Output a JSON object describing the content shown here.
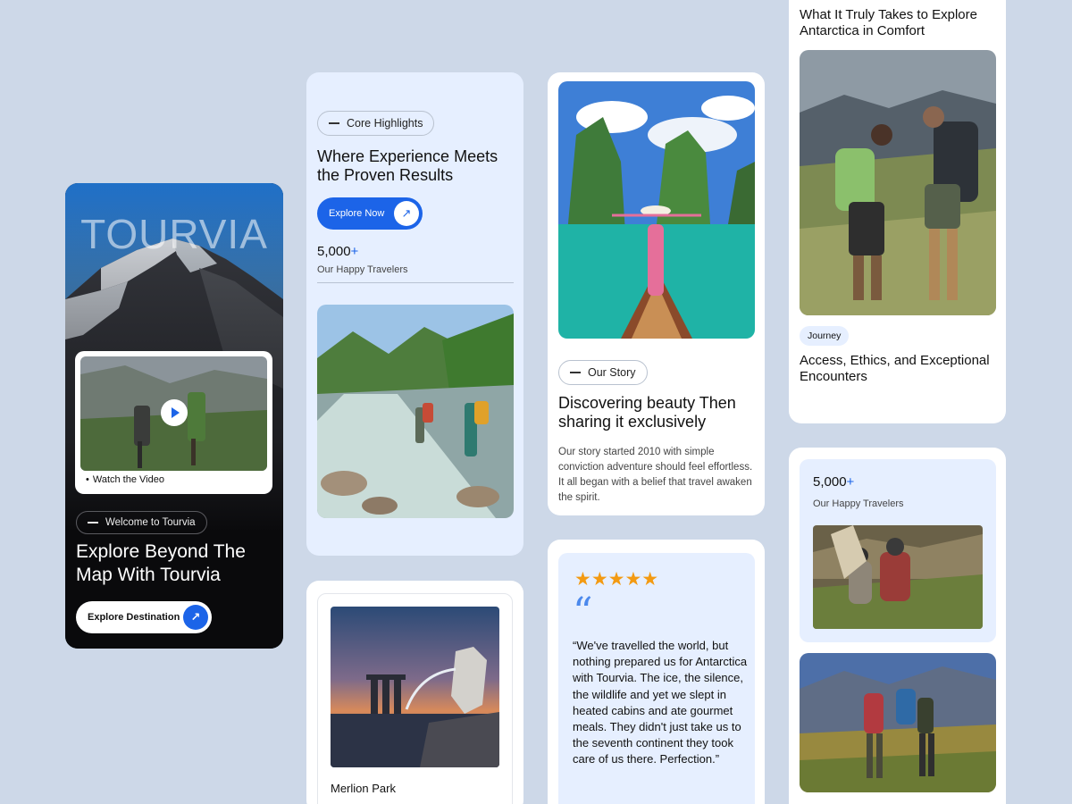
{
  "hero": {
    "brand": "TOURVIA",
    "video_label": "Watch the Video",
    "welcome_pill": "Welcome to Tourvia",
    "title": "Explore Beyond The Map With Tourvia",
    "cta_label": "Explore Destination",
    "cta_icon": "arrow-up-right-icon"
  },
  "highlights": {
    "pill": "Core Highlights",
    "title": "Where Experience Meets the Proven Results",
    "button_label": "Explore Now",
    "stat_value": "5,000",
    "stat_plus": "+",
    "stat_caption": "Our Happy Travelers"
  },
  "merlion": {
    "label": "Merlion Park"
  },
  "story": {
    "pill": "Our Story",
    "title": "Discovering beauty Then sharing it exclusively",
    "body": "Our story started 2010 with simple conviction adventure should feel effortless. It all began with a belief that travel awaken the spirit."
  },
  "review": {
    "stars": "★★★★★",
    "quote_mark": "“",
    "text": "“We've travelled the world, but nothing prepared us for Antarctica with Tourvia. The ice, the silence, the wildlife and yet we slept in heated cabins and ate gourmet meals. They didn't just take us to the seventh continent they took care of us there. Perfection.”"
  },
  "antarctica": {
    "title": "What It Truly Takes to Explore Antarctica in Comfort",
    "tag": "Journey",
    "subtitle": "Access, Ethics, and Exceptional Encounters"
  },
  "travelers": {
    "stat_value": "5,000",
    "stat_plus": "+",
    "caption": "Our Happy Travelers"
  },
  "colors": {
    "background": "#cdd8e8",
    "accent": "#1c64e8",
    "panel": "#e6efff",
    "star": "#f39a12"
  }
}
